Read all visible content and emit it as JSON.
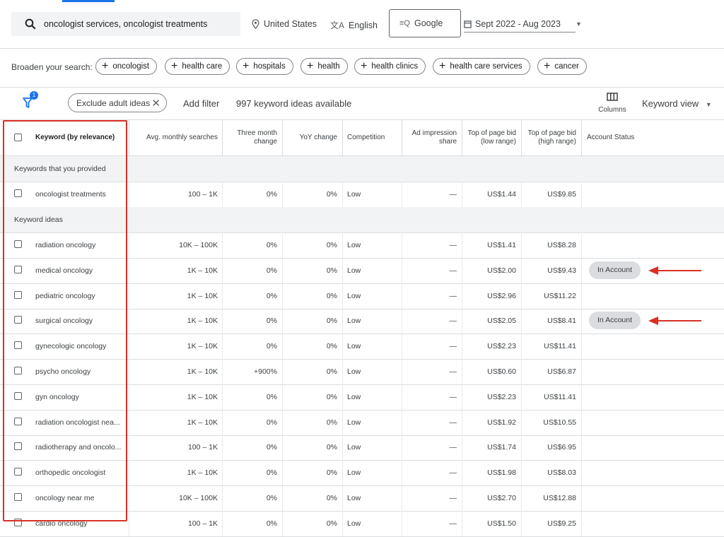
{
  "search": {
    "query": "oncologist services, oncologist treatments",
    "location": "United States",
    "language": "English",
    "network": "Google",
    "date_range": "Sept 2022 - Aug 2023"
  },
  "broaden": {
    "label": "Broaden your search:",
    "chips": [
      "oncologist",
      "health care",
      "hospitals",
      "health",
      "health clinics",
      "health care services",
      "cancer"
    ]
  },
  "filters": {
    "badge": "1",
    "exclude_chip": "Exclude adult ideas",
    "add_filter": "Add filter",
    "available": "997 keyword ideas available",
    "columns_label": "Columns",
    "view_label": "Keyword view"
  },
  "table": {
    "headers": [
      "Keyword (by relevance)",
      "Avg. monthly searches",
      "Three month change",
      "YoY change",
      "Competition",
      "Ad impression share",
      "Top of page bid (low range)",
      "Top of page bid (high range)",
      "Account Status"
    ],
    "section_provided": "Keywords that you provided",
    "section_ideas": "Keyword ideas",
    "provided": [
      {
        "keyword": "oncologist treatments",
        "searches": "100 – 1K",
        "three_month": "0%",
        "yoy": "0%",
        "competition": "Low",
        "impression": "—",
        "bid_low": "US$1.44",
        "bid_high": "US$9.85",
        "status": ""
      }
    ],
    "ideas": [
      {
        "keyword": "radiation oncology",
        "searches": "10K – 100K",
        "three_month": "0%",
        "yoy": "0%",
        "competition": "Low",
        "impression": "—",
        "bid_low": "US$1.41",
        "bid_high": "US$8.28",
        "status": ""
      },
      {
        "keyword": "medical oncology",
        "searches": "1K – 10K",
        "three_month": "0%",
        "yoy": "0%",
        "competition": "Low",
        "impression": "—",
        "bid_low": "US$2.00",
        "bid_high": "US$9.43",
        "status": "In Account"
      },
      {
        "keyword": "pediatric oncology",
        "searches": "1K – 10K",
        "three_month": "0%",
        "yoy": "0%",
        "competition": "Low",
        "impression": "—",
        "bid_low": "US$2.96",
        "bid_high": "US$11.22",
        "status": ""
      },
      {
        "keyword": "surgical oncology",
        "searches": "1K – 10K",
        "three_month": "0%",
        "yoy": "0%",
        "competition": "Low",
        "impression": "—",
        "bid_low": "US$2.05",
        "bid_high": "US$8.41",
        "status": "In Account"
      },
      {
        "keyword": "gynecologic oncology",
        "searches": "1K – 10K",
        "three_month": "0%",
        "yoy": "0%",
        "competition": "Low",
        "impression": "—",
        "bid_low": "US$2.23",
        "bid_high": "US$11.41",
        "status": ""
      },
      {
        "keyword": "psycho oncology",
        "searches": "1K – 10K",
        "three_month": "+900%",
        "yoy": "0%",
        "competition": "Low",
        "impression": "—",
        "bid_low": "US$0.60",
        "bid_high": "US$6.87",
        "status": ""
      },
      {
        "keyword": "gyn oncology",
        "searches": "1K – 10K",
        "three_month": "0%",
        "yoy": "0%",
        "competition": "Low",
        "impression": "—",
        "bid_low": "US$2.23",
        "bid_high": "US$11.41",
        "status": ""
      },
      {
        "keyword": "radiation oncologist nea...",
        "searches": "1K – 10K",
        "three_month": "0%",
        "yoy": "0%",
        "competition": "Low",
        "impression": "—",
        "bid_low": "US$1.92",
        "bid_high": "US$10.55",
        "status": ""
      },
      {
        "keyword": "radiotherapy and oncolo...",
        "searches": "100 – 1K",
        "three_month": "0%",
        "yoy": "0%",
        "competition": "Low",
        "impression": "—",
        "bid_low": "US$1.74",
        "bid_high": "US$6.95",
        "status": ""
      },
      {
        "keyword": "orthopedic oncologist",
        "searches": "1K – 10K",
        "three_month": "0%",
        "yoy": "0%",
        "competition": "Low",
        "impression": "—",
        "bid_low": "US$1.98",
        "bid_high": "US$8.03",
        "status": ""
      },
      {
        "keyword": "oncology near me",
        "searches": "10K – 100K",
        "three_month": "0%",
        "yoy": "0%",
        "competition": "Low",
        "impression": "—",
        "bid_low": "US$2.70",
        "bid_high": "US$12.88",
        "status": ""
      },
      {
        "keyword": "cardio oncology",
        "searches": "100 – 1K",
        "three_month": "0%",
        "yoy": "0%",
        "competition": "Low",
        "impression": "—",
        "bid_low": "US$1.50",
        "bid_high": "US$9.25",
        "status": ""
      }
    ]
  },
  "colors": {
    "annotation_red": "#d93025",
    "accent_blue": "#1a73e8"
  }
}
